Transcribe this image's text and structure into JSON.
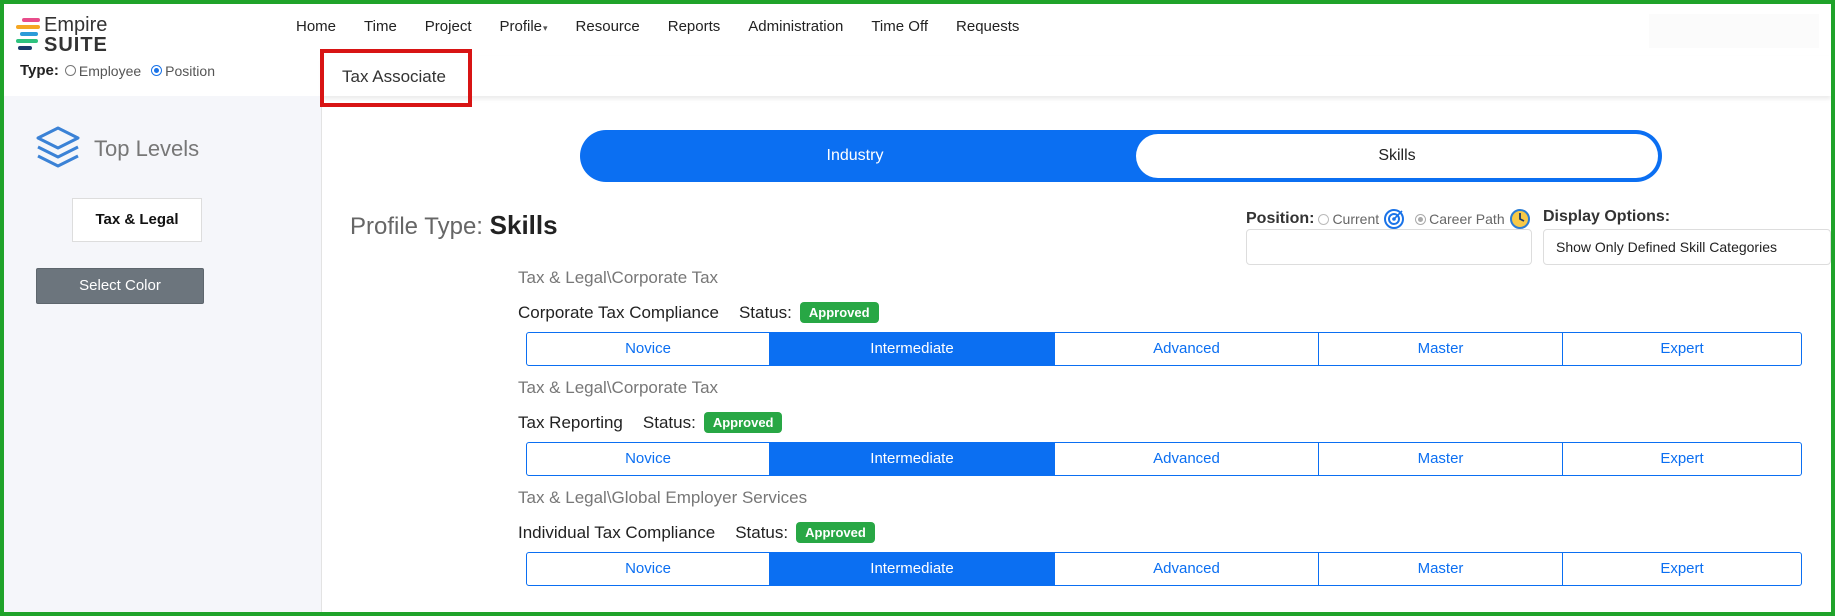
{
  "brand": {
    "line1": "Empire",
    "line2": "SUITE"
  },
  "nav": [
    "Home",
    "Time",
    "Project",
    "Profile",
    "Resource",
    "Reports",
    "Administration",
    "Time Off",
    "Requests"
  ],
  "type_selector": {
    "label": "Type:",
    "options": [
      "Employee",
      "Position"
    ],
    "selected": "Position"
  },
  "page_title": "Tax Associate",
  "sidebar": {
    "heading": "Top Levels",
    "category": "Tax & Legal",
    "select_color": "Select Color"
  },
  "tabs": {
    "industry": "Industry",
    "skills": "Skills",
    "active": "Skills"
  },
  "profile_type": {
    "label": "Profile Type:",
    "value": "Skills"
  },
  "position": {
    "label": "Position:",
    "current": "Current",
    "career_path": "Career Path"
  },
  "display_options": {
    "label": "Display Options:",
    "value": "Show Only Defined Skill Categories"
  },
  "skills": [
    {
      "path": "Tax & Legal\\Corporate Tax",
      "name": "Corporate Tax Compliance",
      "status_label": "Status:",
      "status": "Approved",
      "level": "Intermediate"
    },
    {
      "path": "Tax & Legal\\Corporate Tax",
      "name": "Tax Reporting",
      "status_label": "Status:",
      "status": "Approved",
      "level": "Intermediate"
    },
    {
      "path": "Tax & Legal\\Global Employer Services",
      "name": "Individual Tax Compliance",
      "status_label": "Status:",
      "status": "Approved",
      "level": "Intermediate"
    }
  ],
  "levels": [
    "Novice",
    "Intermediate",
    "Advanced",
    "Master",
    "Expert"
  ],
  "colors": {
    "accent": "#0b6ff2",
    "approved": "#28a745",
    "frame": "#1fa32a",
    "highlight": "#d81414",
    "button_gray": "#6c757d"
  }
}
